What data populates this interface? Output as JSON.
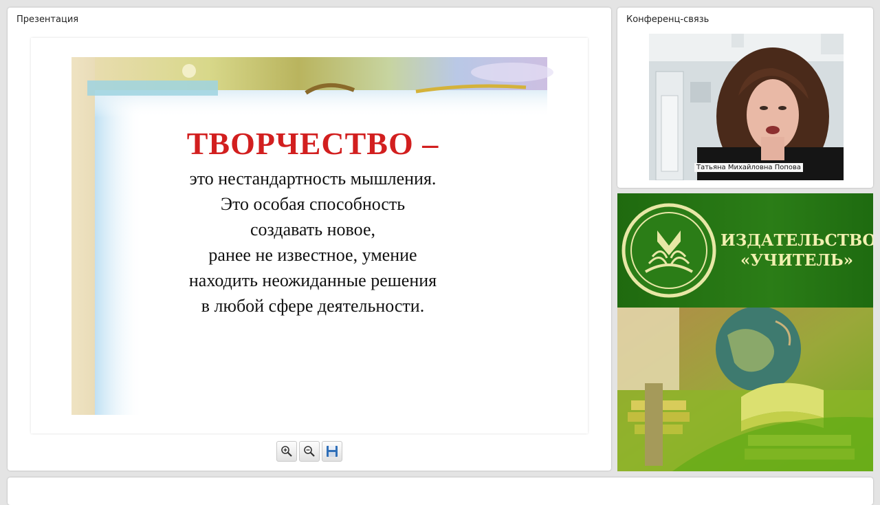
{
  "presentation": {
    "title": "Презентация",
    "slide": {
      "heading": "ТВОРЧЕСТВО –",
      "lines": [
        "это нестандартность мышления.",
        "Это особая способность",
        "создавать новое,",
        "ранее не известное, умение",
        "находить неожиданные решения",
        "в любой сфере деятельности."
      ]
    },
    "toolbar": {
      "zoom_in_icon": "zoom-in-icon",
      "zoom_out_icon": "zoom-out-icon",
      "save_icon": "save-icon"
    }
  },
  "conference": {
    "title": "Конференц-связь",
    "speaker_name": "Татьяна Михайловна Попова"
  },
  "banner": {
    "publisher_line1": "ИЗДАТЕЛЬСТВО",
    "publisher_line2": "«УЧИТЕЛЬ»",
    "colors": {
      "green": "#2b7d17",
      "text": "#f1f0b0"
    }
  }
}
